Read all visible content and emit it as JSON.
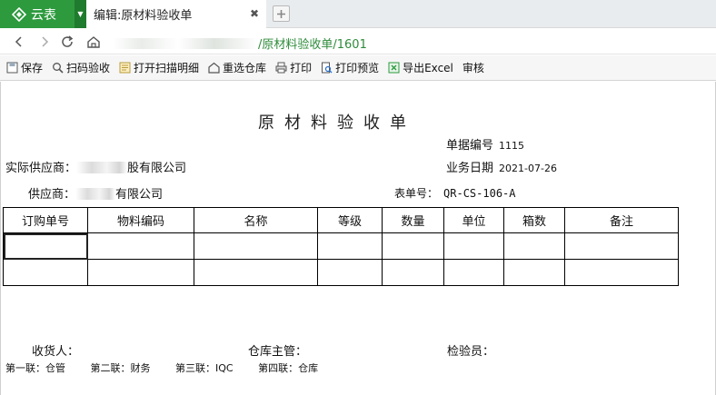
{
  "browser": {
    "brand_label": "云表",
    "tab_title": "编辑:原材料验收单",
    "url_suffix": "/原材料验收单/1601"
  },
  "toolbar": {
    "save": "保存",
    "scan_check": "扫码验收",
    "open_scan_detail": "打开扫描明细",
    "reselect_warehouse": "重选仓库",
    "print": "打印",
    "print_preview": "打印预览",
    "export_excel": "导出Excel",
    "review": "审核"
  },
  "doc": {
    "title": "原材料验收单",
    "doc_no_label": "单据编号",
    "doc_no_value": "1115",
    "actual_supplier_label": "实际供应商：",
    "actual_supplier_value": "股有限公司",
    "business_date_label": "业务日期",
    "business_date_value": "2021-07-26",
    "supplier_label": "供应商：",
    "supplier_value": "有限公司",
    "form_no_label": "表单号：",
    "form_no_value": "QR-CS-106-A",
    "columns": [
      "订购单号",
      "物料编码",
      "名称",
      "等级",
      "数量",
      "单位",
      "箱数",
      "备注"
    ],
    "receiver_label": "收货人：",
    "warehouse_manager_label": "仓库主管：",
    "inspector_label": "检验员：",
    "copies": [
      "第一联：仓管",
      "第二联：财务",
      "第三联：IQC",
      "第四联：仓库"
    ]
  },
  "colors": {
    "brand_green": "#2d9a3e",
    "url_green": "#2e8b3a"
  }
}
